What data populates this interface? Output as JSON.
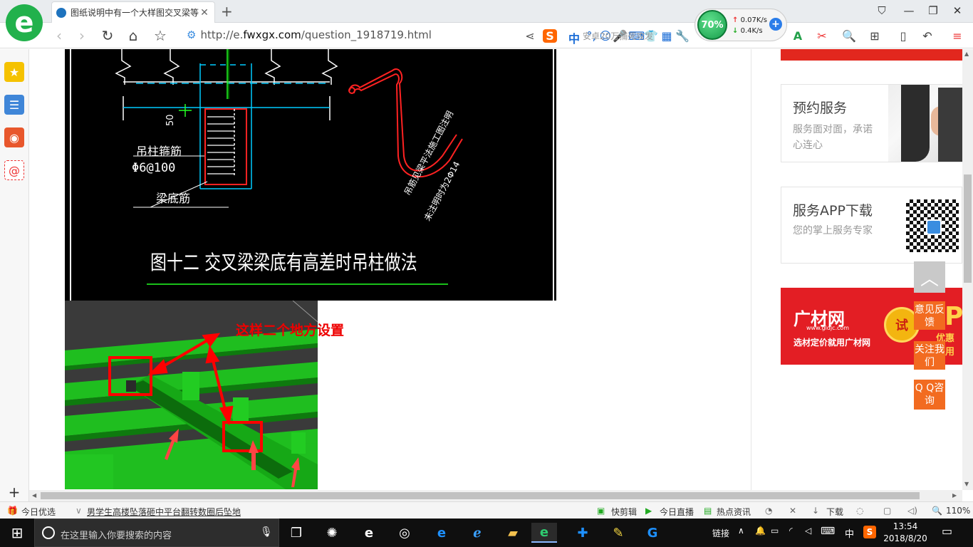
{
  "browser": {
    "tab_title": "图纸说明中有一个大样图交叉梁等",
    "url_prefix": "http://e.",
    "url_domain": "fwxgx.com",
    "url_path": "/question_1918719.html",
    "search_hint": "安卓20万捕死攻发",
    "ime_label": "中",
    "speed": {
      "percent": "70%",
      "up": "0.07K/s",
      "down": "0.4K/s"
    }
  },
  "drawing": {
    "caption": "图十二  交叉梁梁底有高差时吊柱做法",
    "label_stirrup": "吊柱箍筋",
    "label_stirrup_spec": "Φ6@100",
    "label_bottom_bar": "梁底筋",
    "label_dim": "50",
    "label_hanger_1": "吊筋见梁平法施工图注明",
    "label_hanger_2": "未注明时为2Φ14"
  },
  "annotation": "这样二个地方设置",
  "sidebar_cards": [
    {
      "title": "预约服务",
      "desc": "服务面对面，承诺心连心"
    },
    {
      "title": "服务APP下载",
      "desc": "您的掌上服务专家"
    }
  ],
  "promo": {
    "brand": "广材网",
    "brand_url": "www.gldjc.com",
    "slogan": "选材定价就用广材网",
    "badge": "试",
    "big_letter": "P",
    "try_text": "优惠试用"
  },
  "float_buttons": [
    "意见反馈",
    "关注我们",
    "Q Q咨询"
  ],
  "status_bar": {
    "left_label": "今日优选",
    "news": "男学生高楼坠落砸中平台翻转数圈后坠地",
    "items": [
      "快剪辑",
      "今日直播",
      "热点资讯",
      "下载"
    ],
    "zoom": "110%"
  },
  "taskbar": {
    "search_placeholder": "在这里输入你要搜索的内容",
    "tray_link": "链接",
    "ime": "中",
    "time": "13:54",
    "date": "2018/8/20"
  }
}
